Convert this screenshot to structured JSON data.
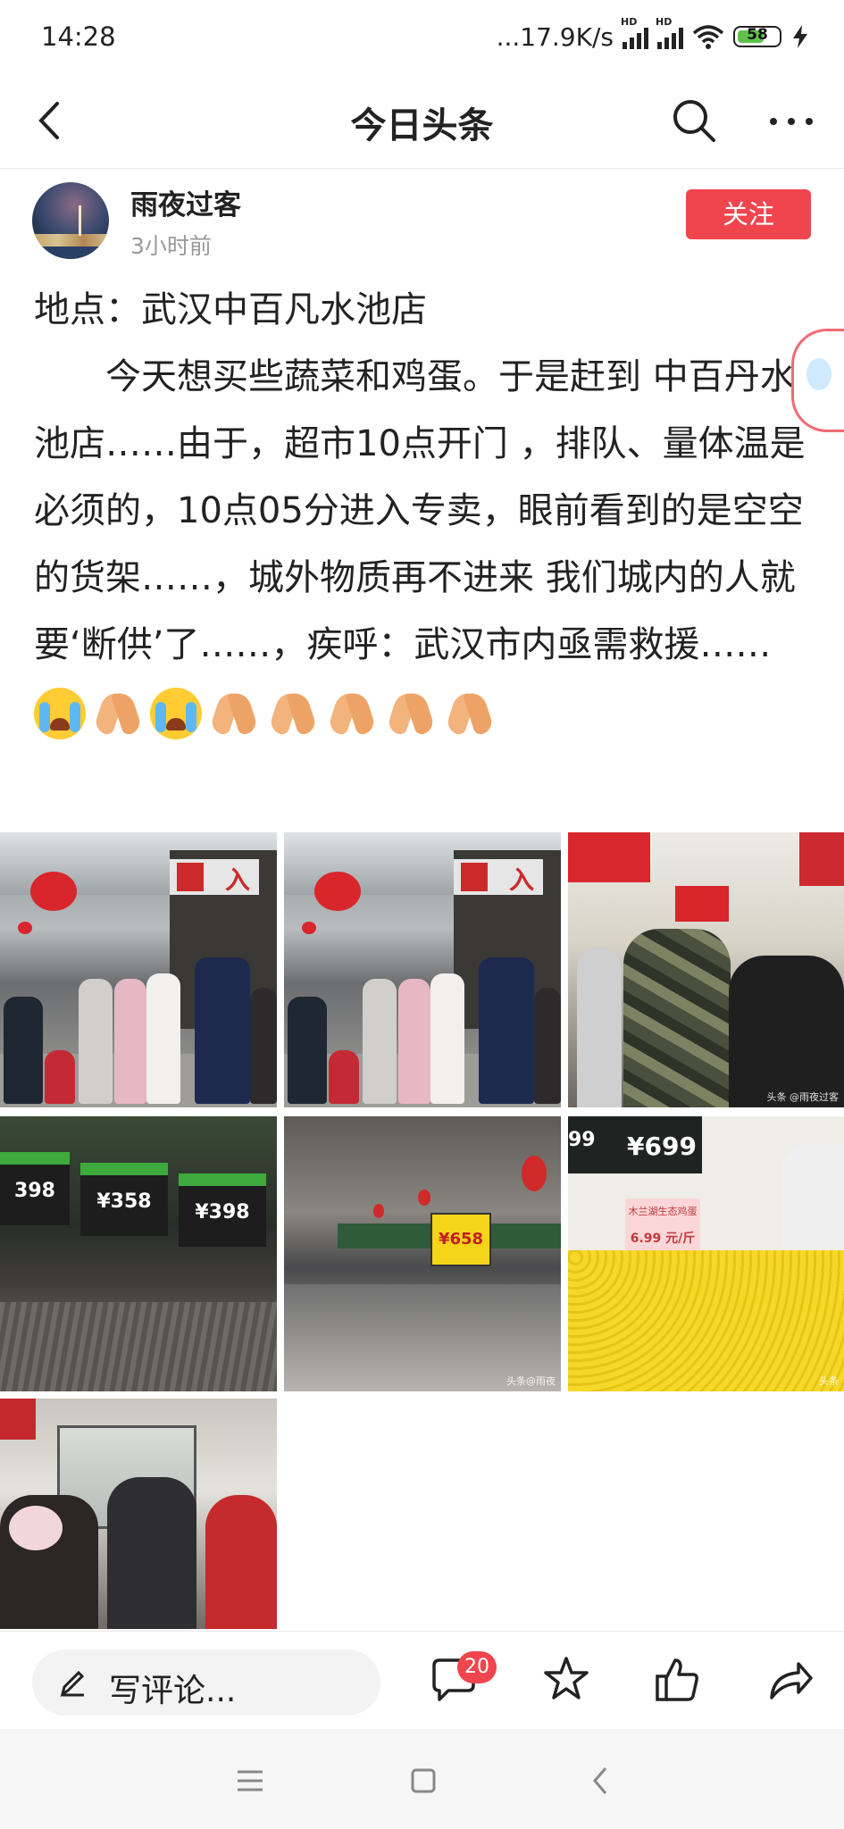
{
  "status_bar": {
    "time": "14:28",
    "network_speed": "...17.9K/s",
    "signal_tag": "HD",
    "battery": "58"
  },
  "nav": {
    "title": "今日头条",
    "icons": [
      "back-arrow-icon",
      "search-icon",
      "more-icon"
    ]
  },
  "author": {
    "name": "雨夜过客",
    "time_ago": "3小时前",
    "follow_label": "关注"
  },
  "post": {
    "line1": "地点：武汉中百凡水池店",
    "body": "今天想买些蔬菜和鸡蛋。于是赶到 中百丹水池店……由于，超市10点开门 ，排队、量体温是必须的，10点05分进入专卖，眼前看到的是空空的货架……，城外物质再不进来 我们城内的人就要‘断供’了……，疾呼：武汉市内亟需救援……",
    "emojis": [
      "crying-face",
      "folded-hands",
      "crying-face",
      "folded-hands",
      "folded-hands",
      "folded-hands",
      "folded-hands",
      "folded-hands"
    ]
  },
  "images": {
    "img1_sign": "入",
    "img2_sign": "入",
    "img3_watermark": "头条 @雨夜过客",
    "img4_tags": [
      "398",
      "¥358",
      "¥398"
    ],
    "img5_tag": "¥658",
    "img5_watermark": "头条@雨夜",
    "img6_prices": [
      "99",
      "¥699"
    ],
    "img6_label": "木兰湖生态鸡蛋",
    "img6_label_price": "6.99 元/斤",
    "img6_watermark": "头条"
  },
  "bottom_bar": {
    "comment_placeholder": "写评论...",
    "comment_count": "20",
    "icons": [
      "comment-icon",
      "star-icon",
      "thumbs-up-icon",
      "share-icon"
    ]
  },
  "system_nav": {
    "icons": [
      "menu-icon",
      "home-icon",
      "back-icon"
    ]
  },
  "colors": {
    "accent": "#f0454d"
  }
}
